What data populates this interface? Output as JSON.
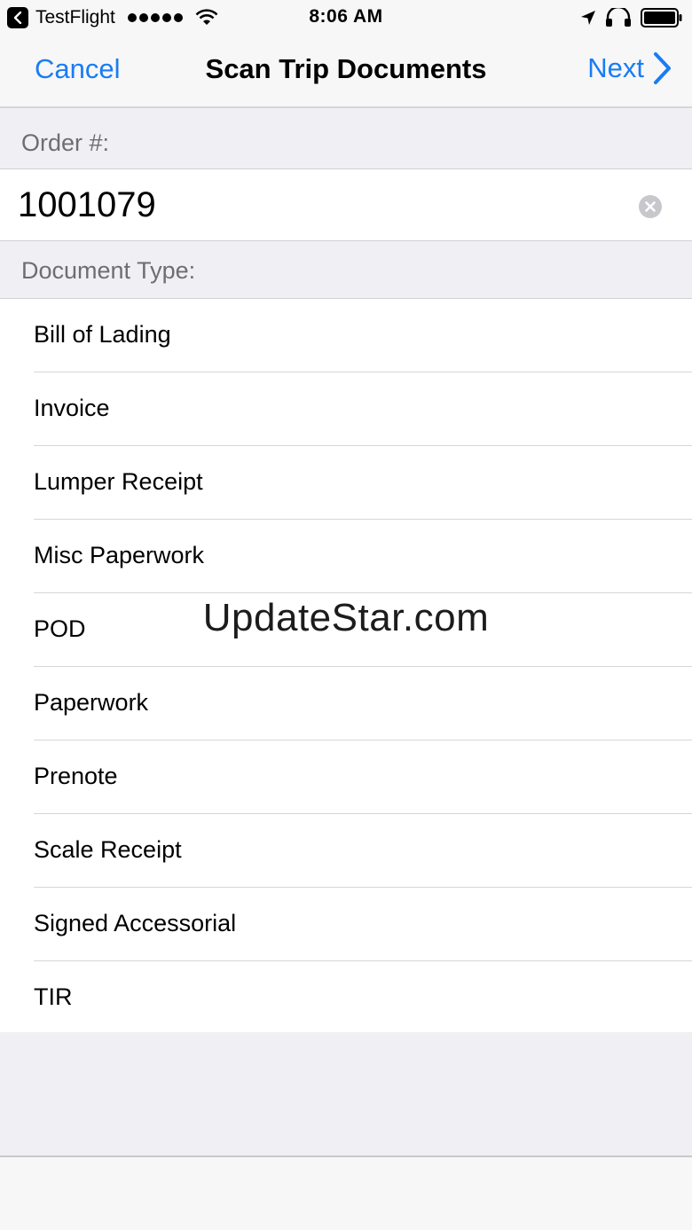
{
  "status_bar": {
    "carrier": "TestFlight",
    "time": "8:06 AM"
  },
  "nav": {
    "cancel_label": "Cancel",
    "title": "Scan Trip Documents",
    "next_label": "Next"
  },
  "order": {
    "header": "Order #:",
    "value": "1001079"
  },
  "document_type": {
    "header": "Document Type:",
    "items": [
      "Bill of Lading",
      "Invoice",
      "Lumper Receipt",
      "Misc Paperwork",
      "POD",
      "Paperwork",
      "Prenote",
      "Scale Receipt",
      "Signed Accessorial",
      "TIR"
    ]
  },
  "watermark": "UpdateStar.com",
  "colors": {
    "accent": "#1a7cf5",
    "background": "#efeff4"
  }
}
